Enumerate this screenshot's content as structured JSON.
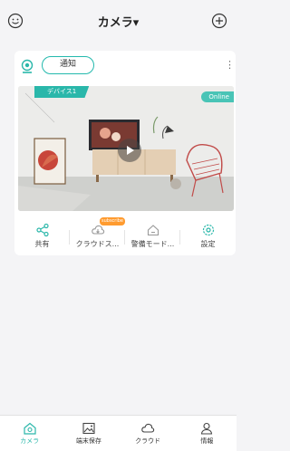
{
  "header": {
    "title": "カメラ▾",
    "left_icon": "smile-face-icon",
    "right_icon": "add-circle-icon"
  },
  "card": {
    "notify_label": "通知",
    "device_tag": "デバイス1",
    "status": "Online",
    "actions": [
      {
        "label": "共有",
        "icon": "share-icon"
      },
      {
        "label": "クラウドス...",
        "icon": "cloud-icon",
        "badge": "subscribe"
      },
      {
        "label": "警備モード...",
        "icon": "home-icon"
      },
      {
        "label": "設定",
        "icon": "gear-icon"
      }
    ]
  },
  "nav": {
    "items": [
      {
        "label": "カメラ",
        "icon": "camera-home-icon",
        "active": true
      },
      {
        "label": "端末保存",
        "icon": "image-icon",
        "active": false
      },
      {
        "label": "クラウド",
        "icon": "cloud-icon",
        "active": false
      },
      {
        "label": "情報",
        "icon": "person-icon",
        "active": false
      }
    ]
  },
  "colors": {
    "accent": "#2ab7aa",
    "badge": "#ff9b2f"
  }
}
